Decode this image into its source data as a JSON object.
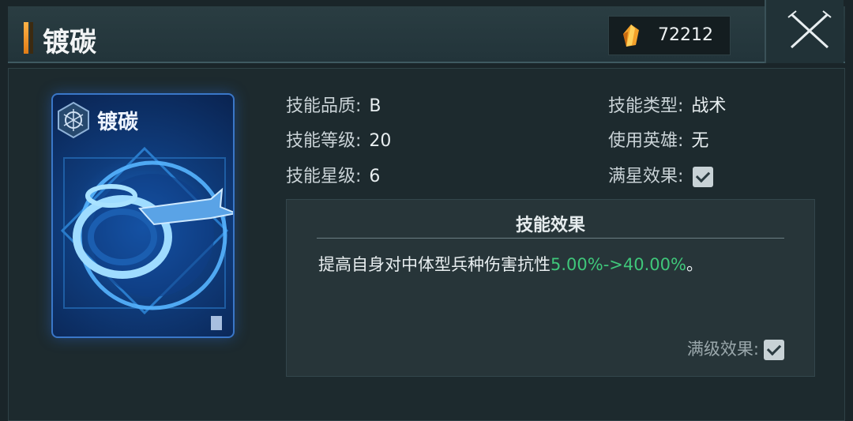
{
  "header": {
    "title": "镀碳",
    "currency_value": "72212",
    "currency_icon": "crystal-icon",
    "close_icon": "close-icon"
  },
  "card": {
    "name": "镀碳",
    "emblem_icon": "hexagon-emblem-icon",
    "art": "ring-aircraft-art"
  },
  "attributes": {
    "quality_label": "技能品质:",
    "quality_value": "B",
    "level_label": "技能等级:",
    "level_value": "20",
    "star_label": "技能星级:",
    "star_value": "6",
    "type_label": "技能类型:",
    "type_value": "战术",
    "hero_label": "使用英雄:",
    "hero_value": "无",
    "max_star_label": "满星效果:",
    "max_star_checked": true
  },
  "effect": {
    "title": "技能效果",
    "text_prefix": "提高自身对中体型兵种伤害抗性",
    "text_highlight": "5.00%->40.00%",
    "text_suffix": "。",
    "max_level_label": "满级效果:",
    "max_level_checked": true
  },
  "colors": {
    "highlight_green": "#3fc77a",
    "accent_orange": "#f0962a",
    "card_blue": "#1e6fd0"
  }
}
